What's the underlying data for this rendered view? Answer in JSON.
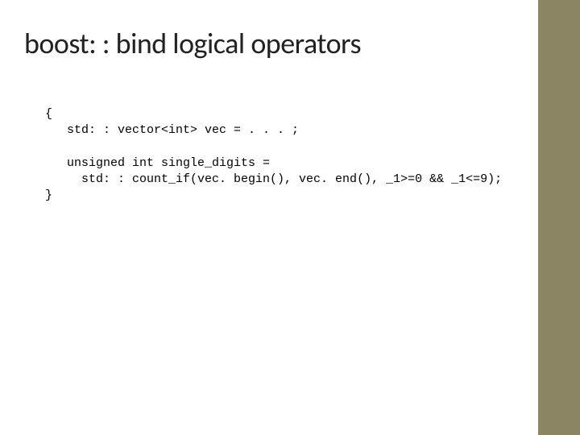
{
  "slide": {
    "title": "boost: : bind logical operators",
    "code": "{\n   std: : vector<int> vec = . . . ;\n\n   unsigned int single_digits =\n     std: : count_if(vec. begin(), vec. end(), _1>=0 && _1<=9);\n}"
  },
  "colors": {
    "sidebar": "#8c8563"
  }
}
